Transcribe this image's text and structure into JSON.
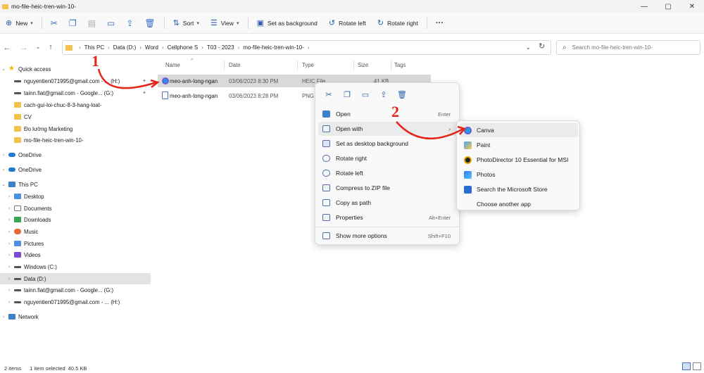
{
  "window": {
    "title": "mo-file-heic-tren-win-10-",
    "controls": [
      "—",
      "▢",
      "✕"
    ]
  },
  "toolbar": {
    "new_label": "New",
    "sort_label": "Sort",
    "view_label": "View",
    "set_bg_label": "Set as background",
    "rotate_left_label": "Rotate left",
    "rotate_right_label": "Rotate right",
    "more_label": "···"
  },
  "address": {
    "crumbs": [
      "This PC",
      "Data (D:)",
      "Word",
      "Cellphone S",
      "T03 - 2023",
      "mo-file-heic-tren-win-10-"
    ],
    "search_placeholder": "Search mo-file-heic-tren-win-10-"
  },
  "nav": {
    "quick_access": "Quick access",
    "items": [
      "nguyentien071995@gmail.com - ... (H:)",
      "tainn.fiat@gmail.com - Google... (G:)",
      "cach-gui-loi-chuc-8-3-hang-loat-",
      "CV",
      "Đo lường Marketing",
      "mo-file-heic-tren-win-10-"
    ],
    "onedrive1": "OneDrive",
    "onedrive2": "OneDrive",
    "this_pc": "This PC",
    "pc_items": [
      "Desktop",
      "Documents",
      "Downloads",
      "Music",
      "Pictures",
      "Videos",
      "Windows (C:)",
      "Data (D:)",
      "tainn.fiat@gmail.com - Google... (G:)",
      "nguyentien071995@gmail.com - ... (H:)"
    ],
    "network": "Network"
  },
  "columns": {
    "name": "Name",
    "date": "Date",
    "type": "Type",
    "size": "Size",
    "tags": "Tags"
  },
  "files": [
    {
      "name": "meo-anh-long-ngan",
      "date": "03/06/2023 8:30 PM",
      "type": "HEIC File",
      "size": "41 KB"
    },
    {
      "name": "meo-anh-long-ngan",
      "date": "03/06/2023 8:28 PM",
      "type": "PNG",
      "size": ""
    }
  ],
  "context_menu": {
    "open": "Open",
    "open_sc": "Enter",
    "open_with": "Open with",
    "set_desktop_bg": "Set as desktop background",
    "rotate_right": "Rotate right",
    "rotate_left": "Rotate left",
    "compress": "Compress to ZIP file",
    "copy_path": "Copy as path",
    "properties": "Properties",
    "properties_sc": "Alt+Enter",
    "show_more": "Show more options",
    "show_more_sc": "Shift+F10"
  },
  "open_with_menu": [
    "Canva",
    "Paint",
    "PhotoDirector 10 Essential for MSI",
    "Photos",
    "Search the Microsoft Store",
    "Choose another app"
  ],
  "annotations": {
    "step1": "1",
    "step2": "2"
  },
  "status": {
    "items": "2 items",
    "selected": "1 item selected",
    "size": "40.5 KB"
  },
  "colors": {
    "accent": "#2b5fad",
    "annotation": "#e3261b",
    "folder": "#f2c14e"
  }
}
